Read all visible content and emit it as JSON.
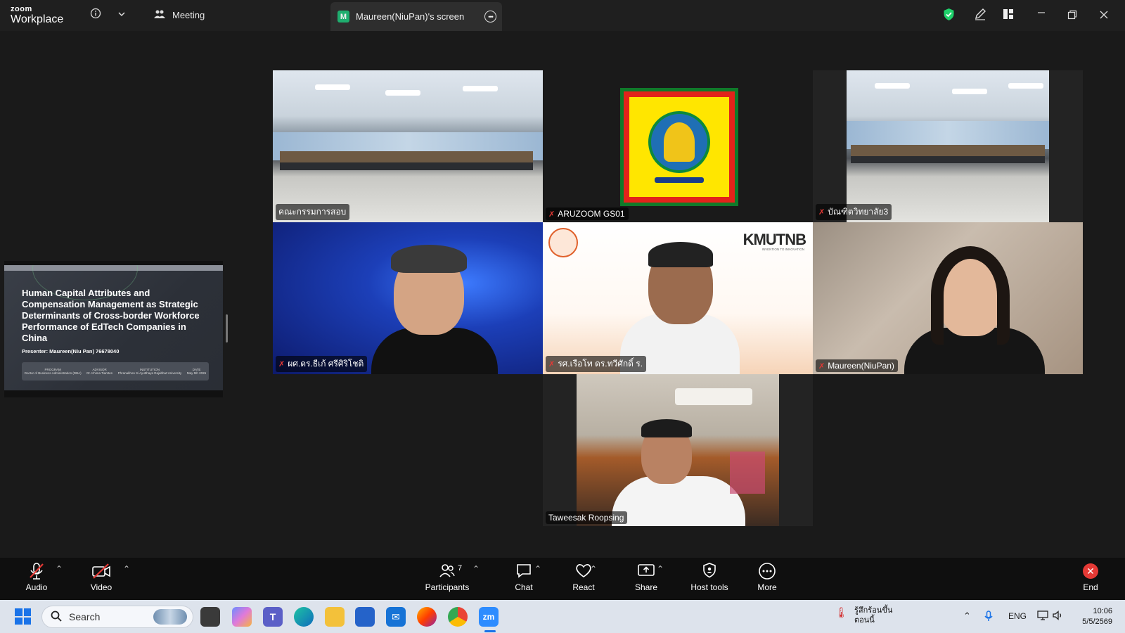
{
  "titlebar": {
    "logo_top": "zoom",
    "logo_bottom": "Workplace",
    "meeting_label": "Meeting",
    "screen_tab_avatar": "M",
    "screen_tab_label": "Maureen(NiuPan)'s screen",
    "icons": [
      "info-icon",
      "chevron-down-icon",
      "participants-icon",
      "more-icon",
      "shield-icon",
      "pen-icon",
      "layout-icon",
      "minimize-icon",
      "restore-icon",
      "close-icon"
    ],
    "shield_color": "#1fd16b"
  },
  "shared_screen": {
    "slide_title": "Human Capital Attributes and Compensation Management as Strategic Determinants of Cross-border Workforce Performance of EdTech Companies in China",
    "presenter": "Presenter: Maureen(Niu Pan) 76678040",
    "footer_items": [
      {
        "label": "PROGRAM",
        "value": "Doctor of Business Administration (DBA)"
      },
      {
        "label": "ADVISOR",
        "value": "Dr. Khima Tiamtes"
      },
      {
        "label": "INSTITUTION",
        "value": "Phranakhon Si Ayutthaya Rajabhat University"
      },
      {
        "label": "DATE",
        "value": "May 5th 2026"
      }
    ]
  },
  "participants": [
    {
      "name": "คณะกรรมการสอบ",
      "muted": false,
      "active": true
    },
    {
      "name": "ARUZOOM GS01",
      "muted": true,
      "active": false
    },
    {
      "name": "บัณฑิตวิทยาลัย3",
      "muted": true,
      "active": false
    },
    {
      "name": "ผศ.ดร.ธีเก้ ศรีศิริโชติ",
      "muted": true,
      "active": false
    },
    {
      "name": "รศ.เรือโท ดร.ทวีศักดิ์ ร.",
      "muted": true,
      "active": false
    },
    {
      "name": "Maureen(NiuPan)",
      "muted": true,
      "active": false
    },
    {
      "name": "Taweesak Roopsing",
      "muted": false,
      "active": false
    }
  ],
  "kmutnb_logo": "KMUTNB",
  "kmutnb_tagline": "INVENTION TO INNOVATION",
  "toolbar": {
    "audio": "Audio",
    "video": "Video",
    "participants": "Participants",
    "participants_count": "7",
    "chat": "Chat",
    "react": "React",
    "share": "Share",
    "host_tools": "Host tools",
    "more": "More",
    "end": "End",
    "end_color": "#e53935"
  },
  "taskbar": {
    "search_placeholder": "Search",
    "weather_line1": "รู้สึกร้อนขึ้น",
    "weather_line2": "ตอนนี้",
    "language": "ENG",
    "time": "10:06",
    "date": "5/5/2569"
  }
}
